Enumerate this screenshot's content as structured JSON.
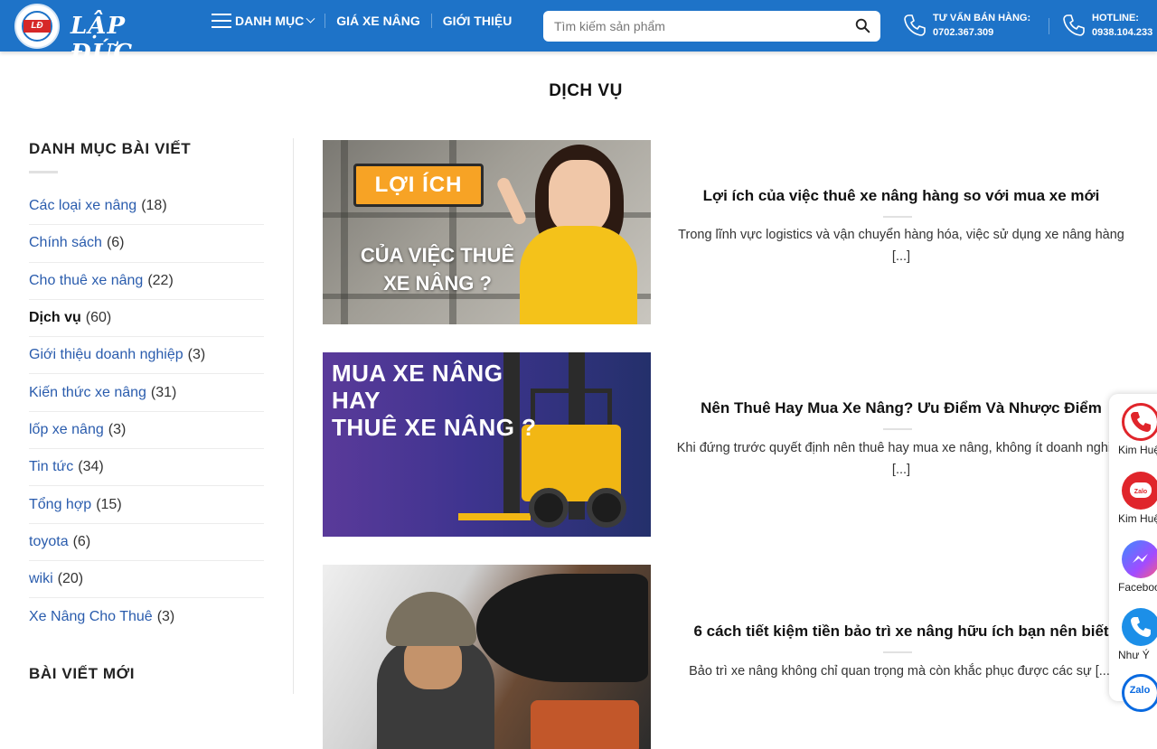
{
  "header": {
    "logo_text": "LẬP ĐỨC",
    "logo_badge": "LĐ",
    "nav": [
      {
        "label": "DANH MỤC"
      },
      {
        "label": "GIÁ XE NÂNG"
      },
      {
        "label": "GIỚI THIỆU"
      }
    ],
    "search": {
      "placeholder": "Tìm kiếm sản phẩm",
      "value": ""
    },
    "sales": {
      "label": "TƯ VẤN BÁN HÀNG:",
      "number": "0702.367.309"
    },
    "hotline": {
      "label": "HOTLINE:",
      "number": "0938.104.233"
    }
  },
  "page": {
    "title": "DỊCH VỤ"
  },
  "sidebar": {
    "categories_title": "DANH MỤC BÀI VIẾT",
    "categories": [
      {
        "name": "Các loại xe nâng",
        "count": "(18)"
      },
      {
        "name": "Chính sách",
        "count": "(6)"
      },
      {
        "name": "Cho thuê xe nâng",
        "count": "(22)"
      },
      {
        "name": "Dịch vụ",
        "count": "(60)"
      },
      {
        "name": "Giới thiệu doanh nghiệp",
        "count": "(3)"
      },
      {
        "name": "Kiến thức xe nâng",
        "count": "(31)"
      },
      {
        "name": "lốp xe nâng",
        "count": "(3)"
      },
      {
        "name": "Tin tức",
        "count": "(34)"
      },
      {
        "name": "Tổng hợp",
        "count": "(15)"
      },
      {
        "name": "toyota",
        "count": "(6)"
      },
      {
        "name": "wiki",
        "count": "(20)"
      },
      {
        "name": "Xe Nâng Cho Thuê",
        "count": "(3)"
      }
    ],
    "recent_title": "BÀI VIẾT MỚI"
  },
  "posts": [
    {
      "title": "Lợi ích của việc thuê xe nâng hàng so với mua xe mới",
      "excerpt": "Trong lĩnh vực logistics và vận chuyển hàng hóa, việc sử dụng xe nâng hàng [...]",
      "thumb": {
        "badge": "LỢI ÍCH",
        "line1": "CỦA VIỆC THUÊ",
        "line2": "XE NÂNG ?"
      }
    },
    {
      "title": "Nên Thuê Hay Mua Xe Nâng? Ưu Điểm Và Nhược Điểm",
      "excerpt": "Khi đứng trước quyết định nên thuê hay mua xe nâng, không ít doanh nghiệp [...]",
      "thumb": {
        "line1": "MUA XE NÂNG",
        "line2": "HAY",
        "line3": "THUÊ XE NÂNG ?"
      }
    },
    {
      "title": "6 cách tiết kiệm tiền bảo trì xe nâng hữu ích bạn nên biết",
      "excerpt": "Bảo trì xe nâng không chỉ quan trọng mà còn khắc phục được các sự [...]"
    }
  ],
  "float_contacts": [
    {
      "label": "Kim Huệ",
      "icon": "phone-icon"
    },
    {
      "label": "Kim Huệ",
      "icon": "zalo-icon"
    },
    {
      "label": "Facebook",
      "icon": "messenger-icon"
    },
    {
      "label": "Như Ý",
      "icon": "phone-icon"
    },
    {
      "label": "Zalo",
      "icon": "zalo-icon"
    }
  ],
  "colors": {
    "header": "#1e73c8",
    "link": "#2a5cad",
    "accent": "#f7a325"
  }
}
